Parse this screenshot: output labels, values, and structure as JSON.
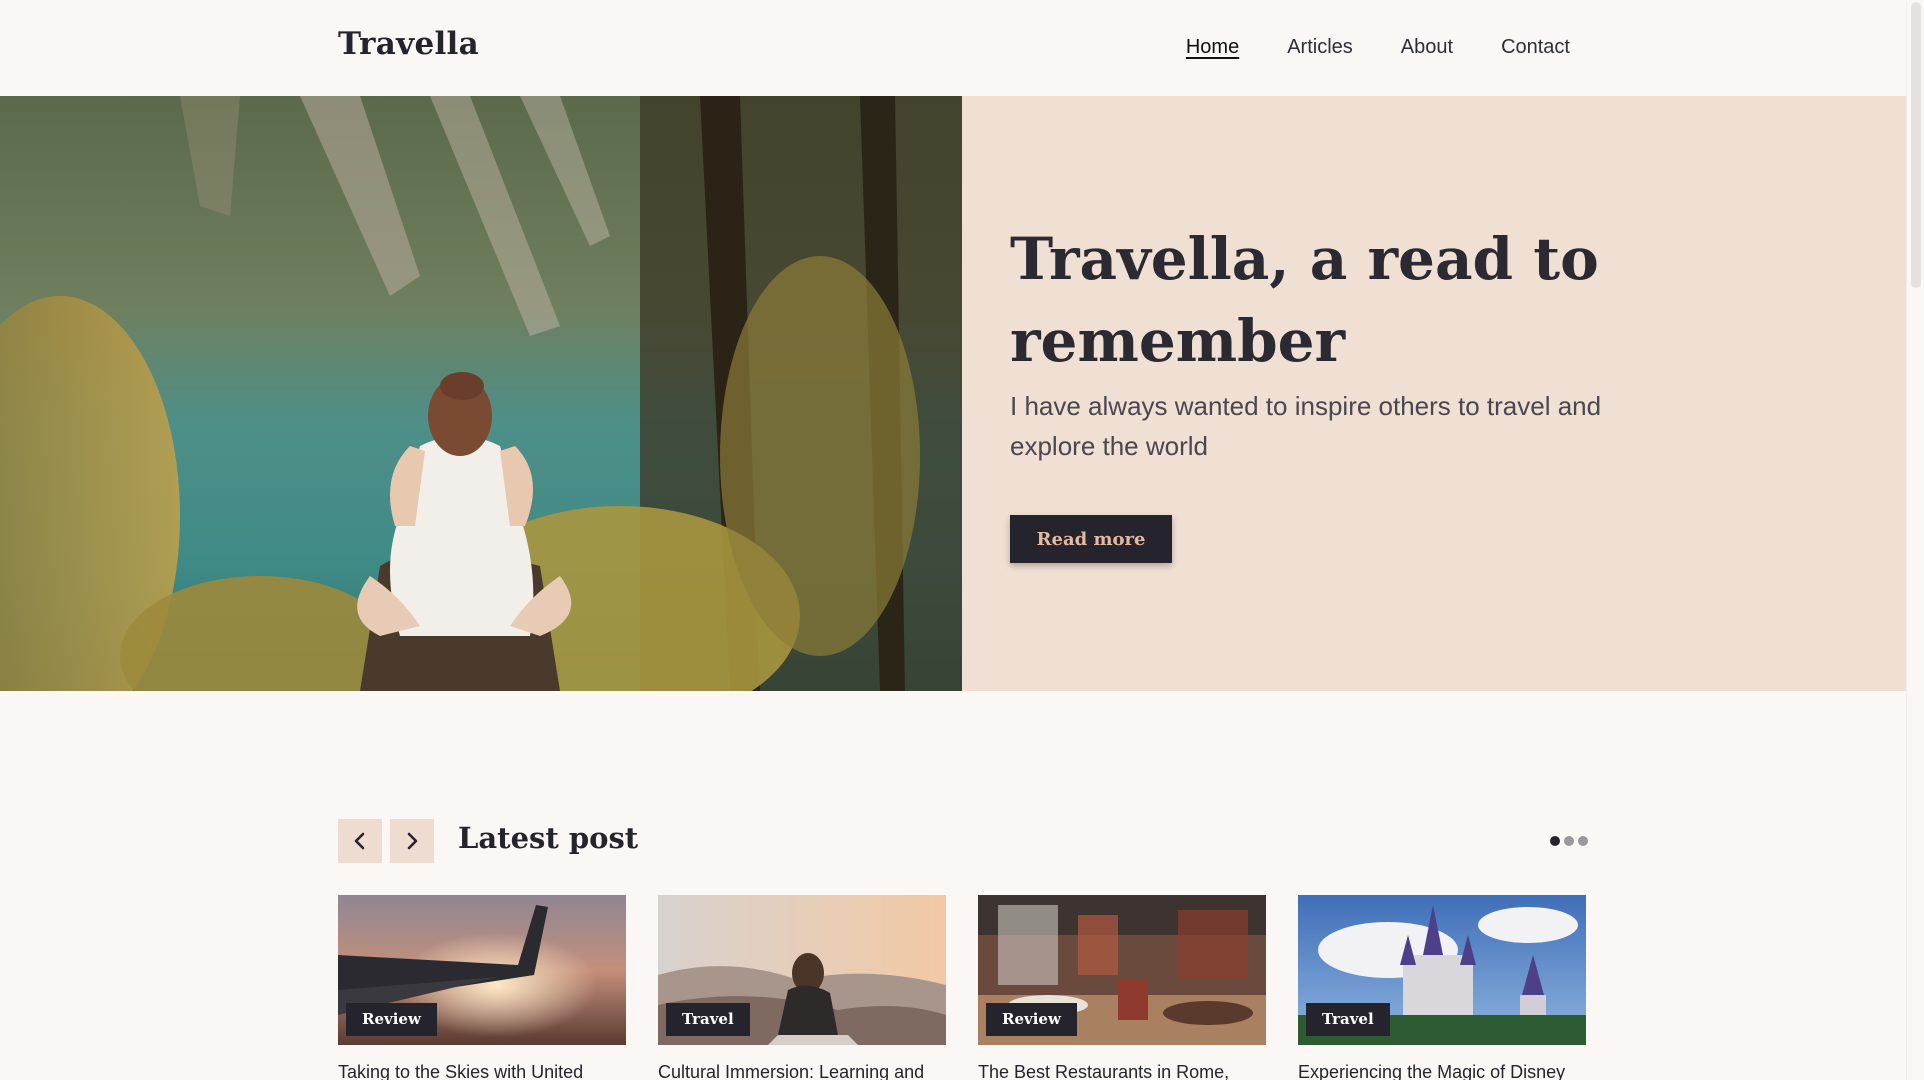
{
  "brand": {
    "name": "Travella"
  },
  "nav": {
    "items": [
      {
        "label": "Home",
        "active": true
      },
      {
        "label": "Articles",
        "active": false
      },
      {
        "label": "About",
        "active": false
      },
      {
        "label": "Contact",
        "active": false
      }
    ]
  },
  "hero": {
    "title": "Travella, a read to remember",
    "text": "I have always wanted to inspire others to travel and explore the world",
    "button_label": "Read more"
  },
  "latest": {
    "title": "Latest post",
    "prev_icon": "chevron-left-icon",
    "next_icon": "chevron-right-icon",
    "pages": 3,
    "active_page": 1,
    "posts": [
      {
        "badge": "Review",
        "title": "Taking to the Skies with United"
      },
      {
        "badge": "Travel",
        "title": "Cultural Immersion: Learning and"
      },
      {
        "badge": "Review",
        "title": "The Best Restaurants in Rome,"
      },
      {
        "badge": "Travel",
        "title": "Experiencing the Magic of Disney"
      }
    ]
  },
  "colors": {
    "background": "#faf7f5",
    "hero_panel": "#f0dfd3",
    "dark": "#25242c",
    "button_text": "#e2b9a2"
  }
}
